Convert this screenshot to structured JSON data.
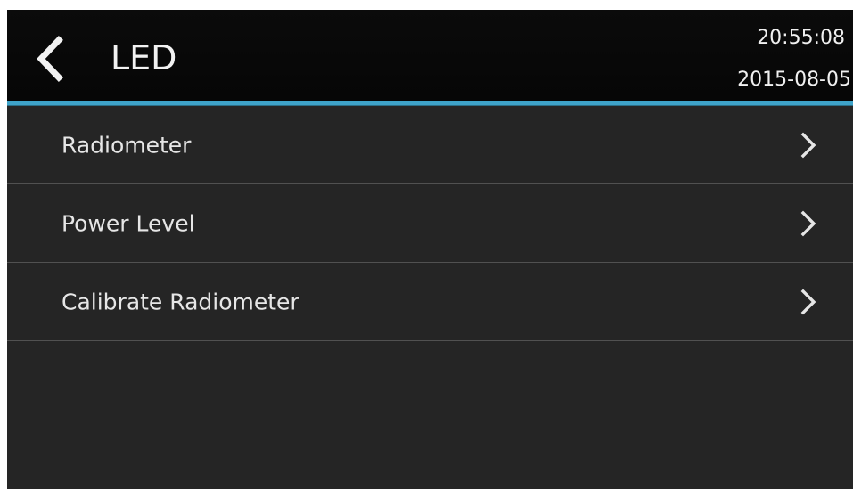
{
  "header": {
    "title": "LED",
    "time": "20:55:08",
    "date": "2015-08-05",
    "back_icon": "chevron-left-icon"
  },
  "menu": {
    "items": [
      {
        "label": "Radiometer",
        "icon": "chevron-right-icon"
      },
      {
        "label": "Power Level",
        "icon": "chevron-right-icon"
      },
      {
        "label": "Calibrate Radiometer",
        "icon": "chevron-right-icon"
      }
    ]
  },
  "colors": {
    "background": "#252525",
    "header": "#070707",
    "accent": "#3ea3c9",
    "text": "#e6e6e6",
    "divider": "#515151"
  }
}
